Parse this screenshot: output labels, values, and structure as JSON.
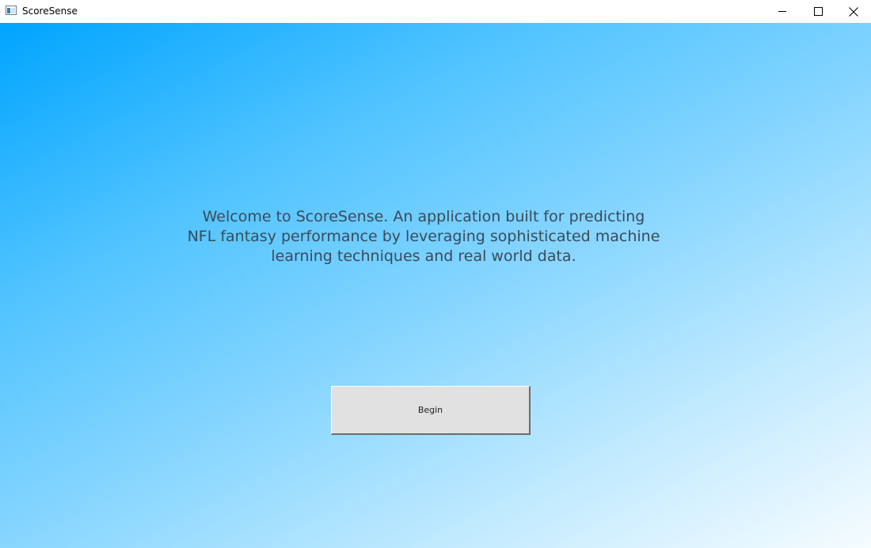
{
  "window": {
    "title": "ScoreSense",
    "controls": [
      "minimize-icon",
      "maximize-icon",
      "close-icon"
    ]
  },
  "main": {
    "welcome_text": "Welcome to ScoreSense. An application built for predicting\nNFL fantasy performance by leveraging sophisticated machine\nlearning techniques and real world data.",
    "begin_label": "Begin"
  },
  "colors": {
    "gradient_start": "#00a4ff",
    "gradient_end": "#f6fcff",
    "text": "#3a4a5a",
    "button_face": "#e1e1e1"
  }
}
